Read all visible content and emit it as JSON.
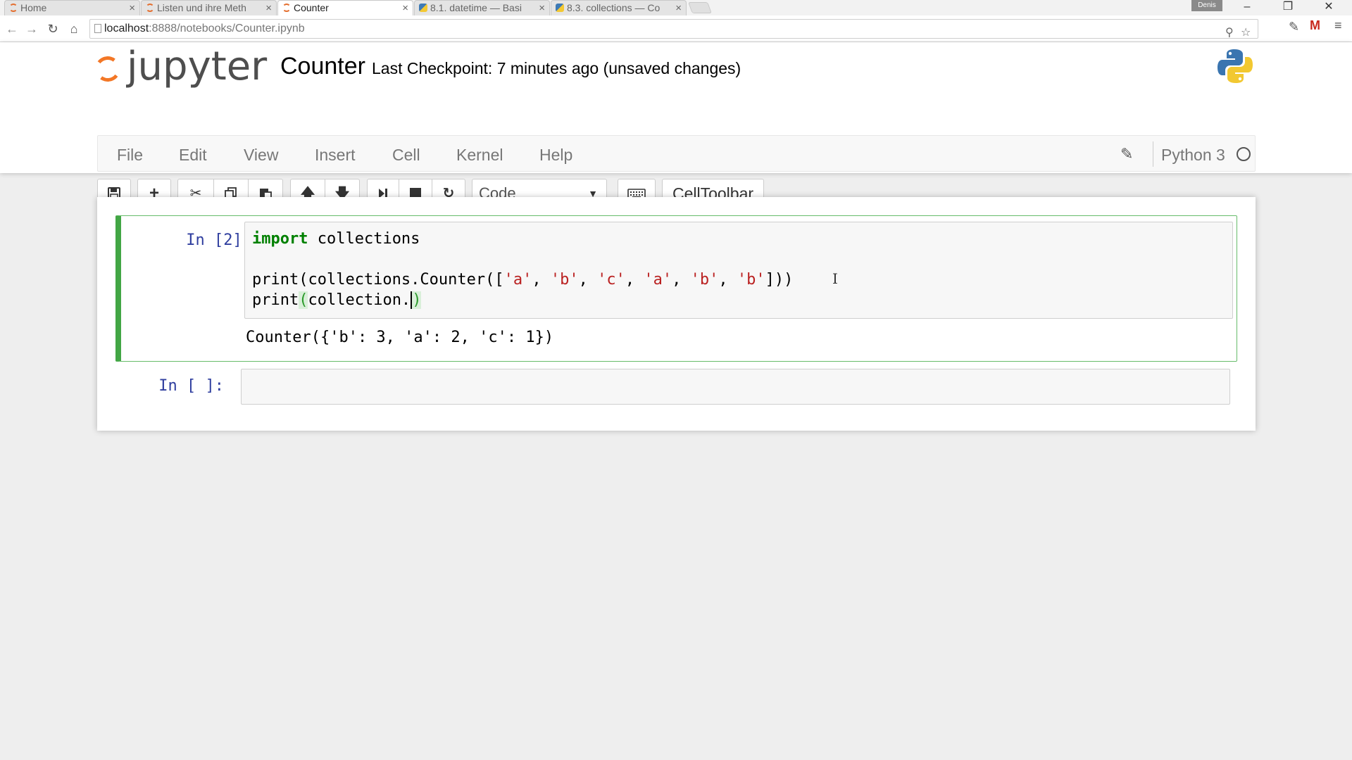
{
  "browser": {
    "tabs": [
      {
        "title": "Home",
        "icon": "jupyter-favicon",
        "active": false
      },
      {
        "title": "Listen und ihre Meth",
        "icon": "jupyter-favicon",
        "active": false
      },
      {
        "title": "Counter",
        "icon": "jupyter-favicon",
        "active": true
      },
      {
        "title": "8.1. datetime — Basi",
        "icon": "python-favicon",
        "active": false
      },
      {
        "title": "8.3. collections — Co",
        "icon": "python-favicon",
        "active": false
      }
    ],
    "close_glyph": "×",
    "user_badge": "Denis",
    "url_host": "localhost",
    "url_rest": ":8888/notebooks/Counter.ipynb",
    "window_controls": {
      "minimize": "–",
      "restore": "❐",
      "close": "✕"
    }
  },
  "header": {
    "logo_text": "jupyter",
    "notebook_name": "Counter",
    "checkpoint": "Last Checkpoint: 7 minutes ago (unsaved changes)"
  },
  "menu": {
    "items": [
      "File",
      "Edit",
      "View",
      "Insert",
      "Cell",
      "Kernel",
      "Help"
    ],
    "kernel_name": "Python 3"
  },
  "toolbar": {
    "cell_type": "Code",
    "celltoolbar_label": "CellToolbar",
    "icons": [
      "save-icon",
      "plus-icon",
      "cut-icon",
      "copy-icon",
      "paste-icon",
      "arrow-up-icon",
      "arrow-down-icon",
      "step-forward-icon",
      "stop-icon",
      "refresh-icon",
      "keyboard-icon"
    ]
  },
  "cells": [
    {
      "prompt": "In [2]:",
      "code": {
        "line1_kw": "import",
        "line1_rest": " collections",
        "line2": "print(collections.Counter([",
        "line2_strs": [
          "'a'",
          "'b'",
          "'c'",
          "'a'",
          "'b'",
          "'b'"
        ],
        "line2_end": "]))",
        "line3_pre": "print",
        "line3_paren": "(",
        "line3_body": "collection.",
        "line3_close": ")"
      },
      "output": "Counter({'b': 3, 'a': 2, 'c': 1})"
    },
    {
      "prompt": "In [ ]:",
      "code": {}
    }
  ]
}
